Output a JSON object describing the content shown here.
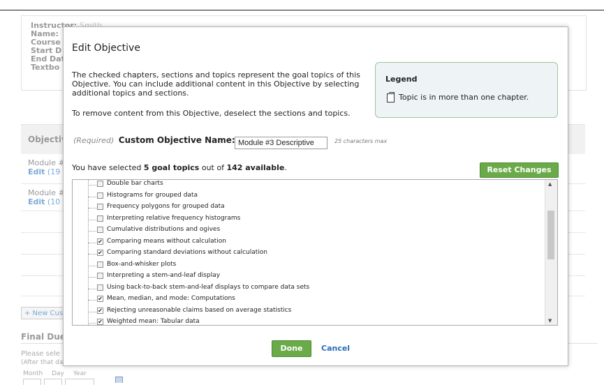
{
  "background": {
    "instructor_label": "Instructor:",
    "instructor_value": "Smith",
    "name_label": "Name:",
    "course_label": "Course",
    "start_label": "Start D",
    "end_label": "End Dat",
    "textbook_label": "Textbo",
    "objectives_header": "Objectiv",
    "rows": [
      {
        "name": "Module #",
        "edit": "Edit",
        "count": "(19"
      },
      {
        "name": "Module #",
        "edit": "Edit",
        "count": "(10"
      }
    ],
    "new_custom_button": "+ New Cus",
    "final_due": "Final Due",
    "please_select": "Please sele",
    "after_that": "(After that day, the scores for all Objectives will be sent to the gradebook.)",
    "date_labels": [
      "Month",
      "Day",
      "Year"
    ]
  },
  "modal": {
    "title": "Edit Objective",
    "intro": "The checked chapters, sections and topics represent the goal topics of this Objective. You can include additional content in this Objective by selecting additional topics and sections.",
    "intro2": "To remove content from this Objective, deselect the sections and topics.",
    "legend": {
      "title": "Legend",
      "icon": "multi-chapter-topic-icon",
      "text": "Topic is in more than one chapter."
    },
    "required_label": "(Required)",
    "name_label": "Custom Objective Name:",
    "name_value": "Module #3 Descriptive",
    "max_note": "25 characters max",
    "selected_prefix": "You have selected ",
    "selected_count": "5 goal topics",
    "selected_mid": " out of ",
    "selected_total": "142 available",
    "selected_suffix": ".",
    "reset_button": "Reset Changes",
    "topics": [
      {
        "label": "Double bar charts",
        "checked": false
      },
      {
        "label": "Histograms for grouped data",
        "checked": false
      },
      {
        "label": "Frequency polygons for grouped data",
        "checked": false
      },
      {
        "label": "Interpreting relative frequency histograms",
        "checked": false
      },
      {
        "label": "Cumulative distributions and ogives",
        "checked": false
      },
      {
        "label": "Comparing means without calculation",
        "checked": true
      },
      {
        "label": "Comparing standard deviations without calculation",
        "checked": true
      },
      {
        "label": "Box-and-whisker plots",
        "checked": false
      },
      {
        "label": "Interpreting a stem-and-leaf display",
        "checked": false
      },
      {
        "label": "Using back-to-back stem-and-leaf displays to compare data sets",
        "checked": false
      },
      {
        "label": "Mean, median, and mode: Computations",
        "checked": true
      },
      {
        "label": "Rejecting unreasonable claims based on average statistics",
        "checked": true
      },
      {
        "label": "Weighted mean: Tabular data",
        "checked": true
      }
    ],
    "done_button": "Done",
    "cancel_link": "Cancel"
  }
}
